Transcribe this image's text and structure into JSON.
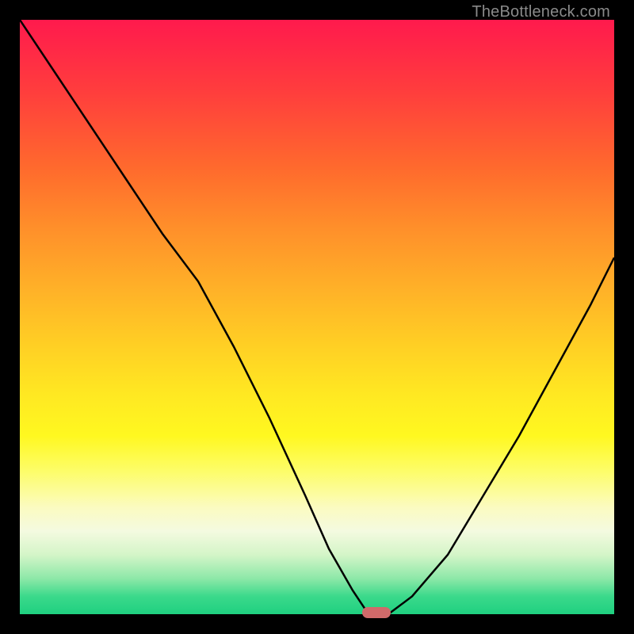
{
  "watermark": "TheBottleneck.com",
  "colors": {
    "background": "#000000",
    "curve_stroke": "#000000",
    "marker": "#d06a6a",
    "gradient_top": "#ff1a4d",
    "gradient_bottom": "#1fd080",
    "watermark_text": "#8a8a8a"
  },
  "chart_data": {
    "type": "line",
    "title": "",
    "xlabel": "",
    "ylabel": "",
    "xlim": [
      0,
      100
    ],
    "ylim": [
      0,
      100
    ],
    "series": [
      {
        "name": "bottleneck-curve",
        "x": [
          0,
          6,
          12,
          18,
          24,
          30,
          36,
          42,
          48,
          52,
          56,
          58,
          60,
          62,
          66,
          72,
          78,
          84,
          90,
          96,
          100
        ],
        "values": [
          100,
          91,
          82,
          73,
          64,
          56,
          45,
          33,
          20,
          11,
          4,
          1,
          0,
          0,
          3,
          10,
          20,
          30,
          41,
          52,
          60
        ]
      }
    ],
    "annotations": [
      {
        "name": "optimal-marker",
        "x": 60,
        "y": 0
      }
    ],
    "legend": false,
    "grid": false
  }
}
